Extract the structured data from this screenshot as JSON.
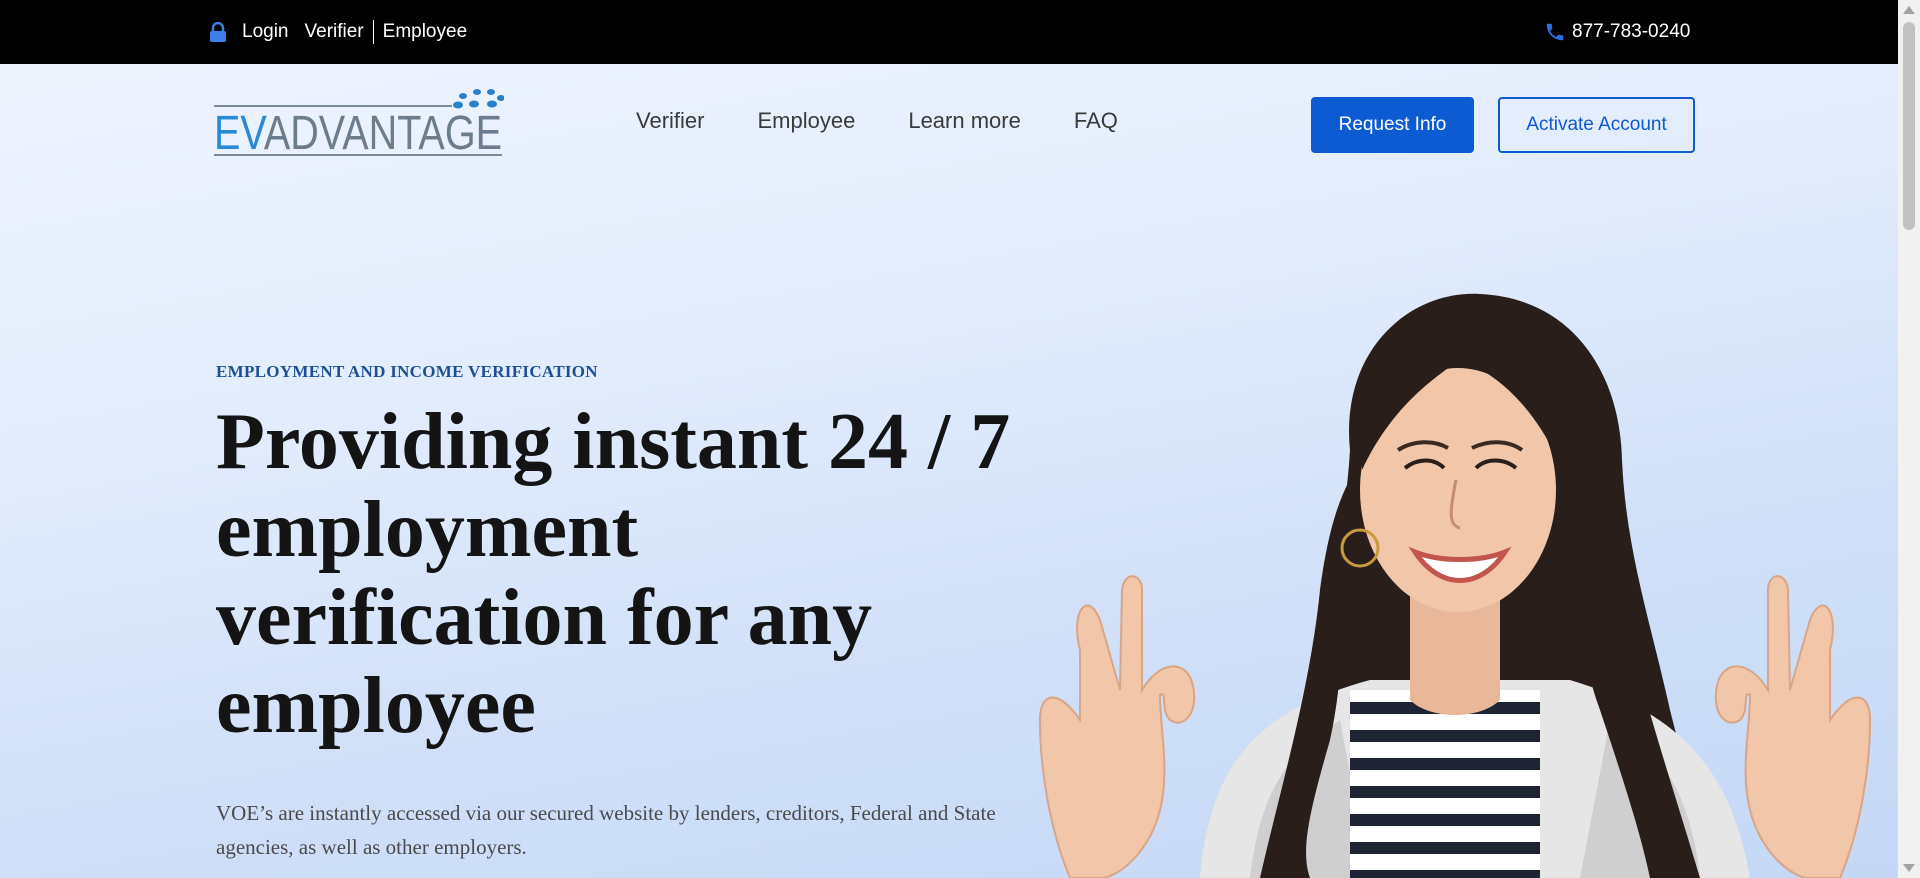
{
  "topbar": {
    "login_label": "Login",
    "verifier_label": "Verifier",
    "employee_label": "Employee",
    "phone": "877-783-0240",
    "lock_icon": "lock-icon",
    "phone_icon": "phone-icon"
  },
  "header": {
    "logo_text": "EVADVANTAGE",
    "nav": [
      "Verifier",
      "Employee",
      "Learn more",
      "FAQ"
    ],
    "request_info_label": "Request Info",
    "activate_account_label": "Activate Account"
  },
  "hero": {
    "eyebrow": "EMPLOYMENT AND INCOME VERIFICATION",
    "headline": "Providing instant 24 / 7 employment verification for any employee",
    "description": "VOE’s are instantly accessed via our secured website by lenders, creditors, Federal and State agencies, as well as other employers."
  },
  "colors": {
    "brand_blue": "#0d5bd3",
    "eyebrow_blue": "#1d4f94",
    "topbar_bg": "#000000"
  }
}
